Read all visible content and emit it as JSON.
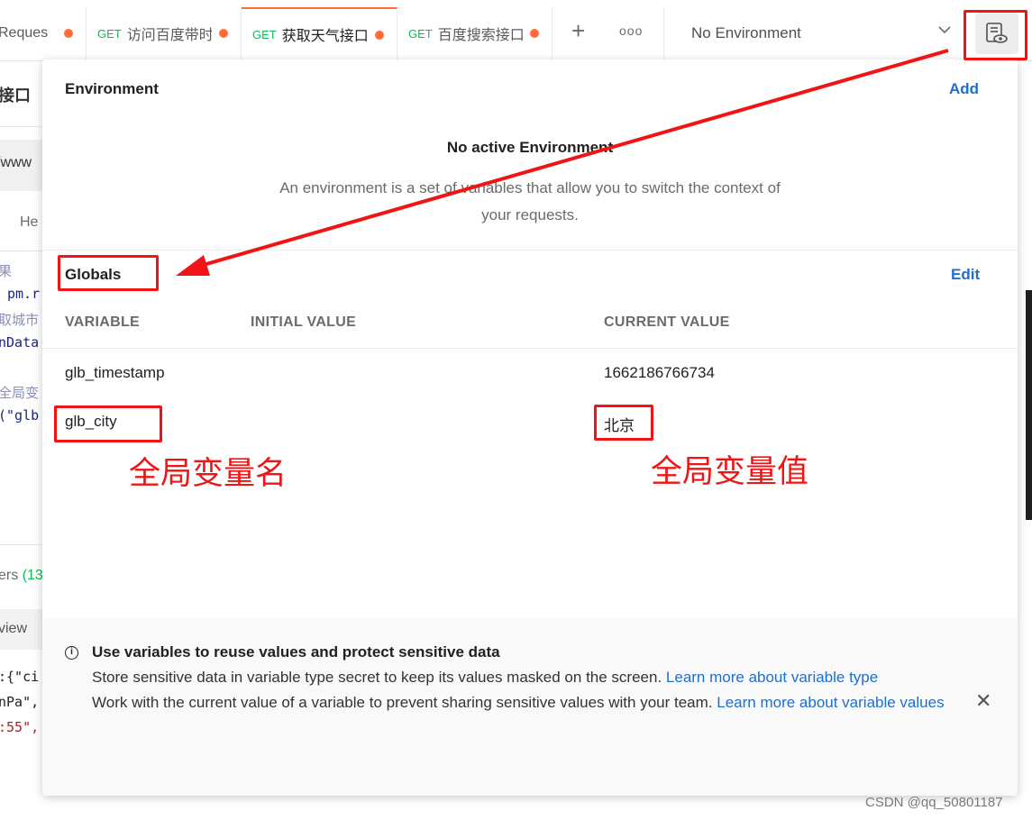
{
  "tabs": [
    {
      "method": "",
      "name": "Reques",
      "unsaved": true
    },
    {
      "method": "GET",
      "name": "访问百度带时",
      "unsaved": true
    },
    {
      "method": "GET",
      "name": "获取天气接口",
      "unsaved": true,
      "active": true
    },
    {
      "method": "GET",
      "name": "百度搜索接口",
      "unsaved": true
    }
  ],
  "toolbar": {
    "new_tab_icon": "+",
    "more_icon": "ooo",
    "environment_selected": "No Environment",
    "environment_chevron": "⌵",
    "env_quick_look_icon": "environment-quick-look-icon"
  },
  "background": {
    "title_fragment": "接口",
    "url_fragment": "/www",
    "tab_fragment": "He",
    "code_lines": [
      "果",
      "pm.r",
      "取城市",
      "nData",
      "全局变",
      "(\"glb"
    ],
    "headers_fragment": "ers",
    "headers_count": "(13",
    "view_fragment": "view",
    "json_lines": [
      ":{\"ci",
      "nPa\",",
      ":55\","
    ]
  },
  "environment_panel": {
    "title": "Environment",
    "add_label": "Add",
    "empty_title": "No active Environment",
    "empty_description": "An environment is a set of variables that allow you to switch the context of your requests.",
    "globals_title": "Globals",
    "edit_label": "Edit",
    "columns": [
      "VARIABLE",
      "INITIAL VALUE",
      "CURRENT VALUE"
    ],
    "rows": [
      {
        "variable": "glb_timestamp",
        "initial": "",
        "current": "1662186766734"
      },
      {
        "variable": "glb_city",
        "initial": "",
        "current": "北京"
      }
    ],
    "tip": {
      "title": "Use variables to reuse values and protect sensitive data",
      "line1": "Store sensitive data in variable type secret to keep its values masked on the screen. ",
      "link1": "Learn more about variable type",
      "line2": "Work with the current value of a variable to prevent sharing sensitive values with your team. ",
      "link2": "Learn more about variable values",
      "close_icon": "✕"
    }
  },
  "annotations": {
    "name_label": "全局变量名",
    "value_label": "全局变量值",
    "accent_color": "#f01414"
  },
  "watermark": "CSDN @qq_50801187"
}
